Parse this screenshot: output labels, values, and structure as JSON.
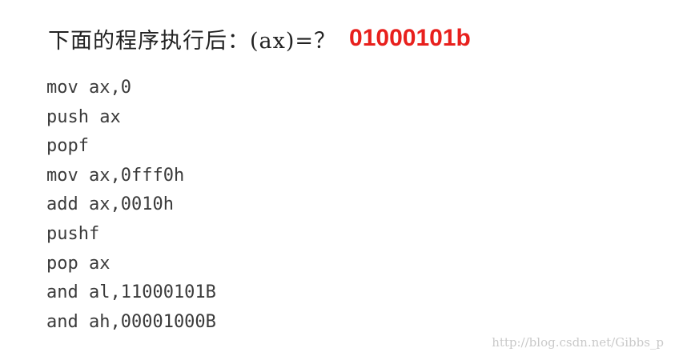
{
  "question": {
    "text": "下面的程序执行后：(ax)=？",
    "answer": "01000101b"
  },
  "code": {
    "lines": [
      "mov ax,0",
      "push ax",
      "popf",
      "mov ax,0fff0h",
      "add ax,0010h",
      "pushf",
      "pop ax",
      "and al,11000101B",
      "and ah,00001000B"
    ]
  },
  "watermark": {
    "text": "http://blog.csdn.net/Gibbs_p"
  },
  "colors": {
    "answer": "#e8201d",
    "text": "#222222",
    "code": "#3a3a3a",
    "watermark": "#c9c9c9",
    "background": "#ffffff"
  }
}
